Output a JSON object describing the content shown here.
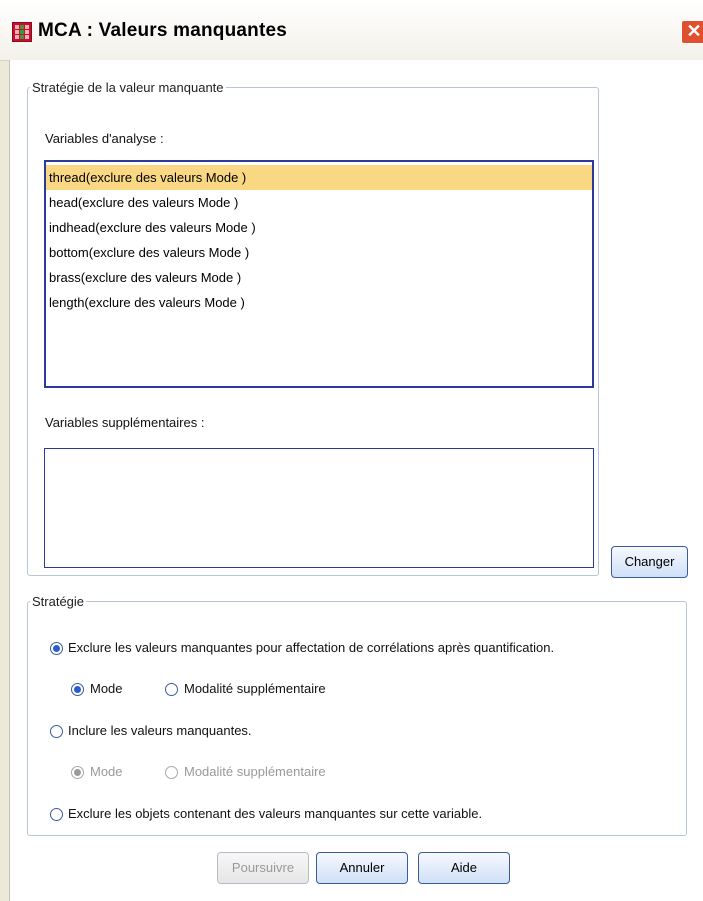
{
  "window": {
    "title": "MCA : Valeurs manquantes"
  },
  "missing_strategy_group": {
    "legend": "Stratégie de la valeur manquante",
    "analysis_label": "Variables d'analyse :",
    "analysis_items": [
      "thread(exclure des valeurs Mode )",
      "head(exclure des valeurs Mode )",
      "indhead(exclure des valeurs Mode )",
      "bottom(exclure des valeurs Mode )",
      "brass(exclure des valeurs Mode )",
      "length(exclure des valeurs Mode )"
    ],
    "selected_index": 0,
    "supplementary_label": "Variables supplémentaires :",
    "change_button": "Changer"
  },
  "strategy_group": {
    "legend": "Stratégie",
    "option_exclude_imputation": "Exclure les valeurs manquantes pour affectation de corrélations après quantification.",
    "exclude_sub_mode": "Mode",
    "exclude_sub_supplementary": "Modalité supplémentaire",
    "option_include": "Inclure les valeurs manquantes.",
    "include_sub_mode": "Mode",
    "include_sub_supplementary": "Modalité supplémentaire",
    "option_exclude_objects": "Exclure les objets contenant des valeurs manquantes sur cette variable."
  },
  "buttons": {
    "continue": "Poursuivre",
    "cancel": "Annuler",
    "help": "Aide"
  },
  "colors": {
    "selection": "#fad883",
    "list_border": "#2b3a9a",
    "close_button": "#e0502f"
  }
}
